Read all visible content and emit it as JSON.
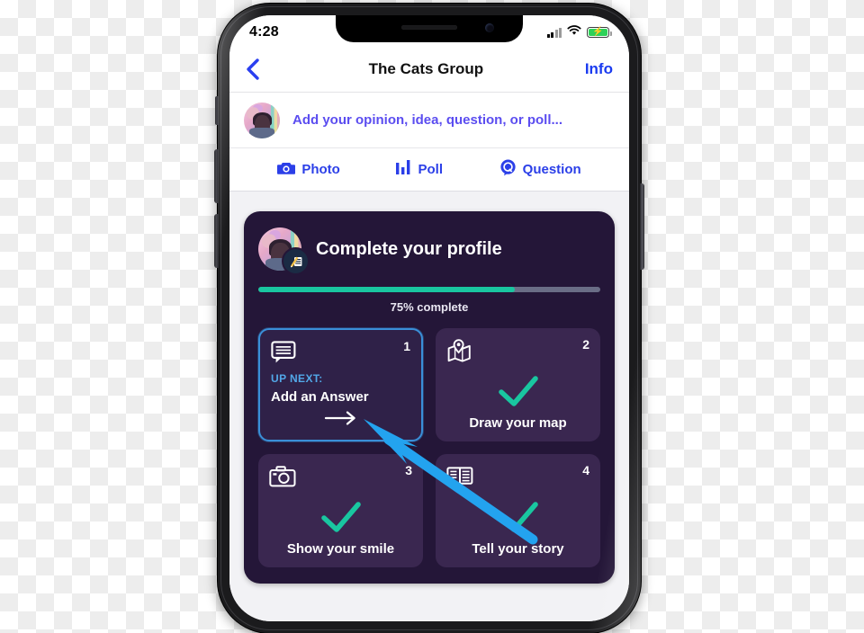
{
  "status_bar": {
    "time": "4:28",
    "signal_icon": "cellular-signal-icon",
    "wifi_icon": "wifi-icon",
    "battery_icon": "battery-charging-icon"
  },
  "nav": {
    "back_icon": "back-chevron-icon",
    "title": "The Cats Group",
    "info_label": "Info"
  },
  "composer": {
    "avatar_icon": "user-avatar",
    "placeholder": "Add your opinion, idea, question, or poll..."
  },
  "actions": [
    {
      "label": "Photo",
      "icon": "camera-icon"
    },
    {
      "label": "Poll",
      "icon": "bar-chart-icon"
    },
    {
      "label": "Question",
      "icon": "question-bubble-icon"
    }
  ],
  "profile_card": {
    "title": "Complete your profile",
    "avatar_icon": "user-avatar",
    "edit_badge_icon": "pencil-edit-icon",
    "progress_percent": 75,
    "progress_label": "75% complete",
    "progress_fill_color": "#19c6a0",
    "progress_track_color": "#6a6d86",
    "card_color": "#241638",
    "tiles": [
      {
        "number": "1",
        "icon": "speech-bubble-icon",
        "eyebrow": "UP NEXT:",
        "title": "Add an Answer",
        "state": "active",
        "arrow_icon": "arrow-right-icon",
        "highlight_color": "#3a8fd8",
        "eyebrow_color": "#52a8e8"
      },
      {
        "number": "2",
        "icon": "map-pin-icon",
        "title": "Draw your map",
        "state": "complete",
        "check_icon": "checkmark-icon",
        "check_color": "#19c6a0"
      },
      {
        "number": "3",
        "icon": "camera-icon",
        "title": "Show your smile",
        "state": "complete",
        "check_icon": "checkmark-icon",
        "check_color": "#19c6a0"
      },
      {
        "number": "4",
        "icon": "open-book-icon",
        "title": "Tell your story",
        "state": "complete",
        "check_icon": "checkmark-icon",
        "check_color": "#19c6a0"
      }
    ]
  },
  "annotation": {
    "arrow_icon": "pointer-arrow-annotation",
    "color": "#23a3ef"
  }
}
